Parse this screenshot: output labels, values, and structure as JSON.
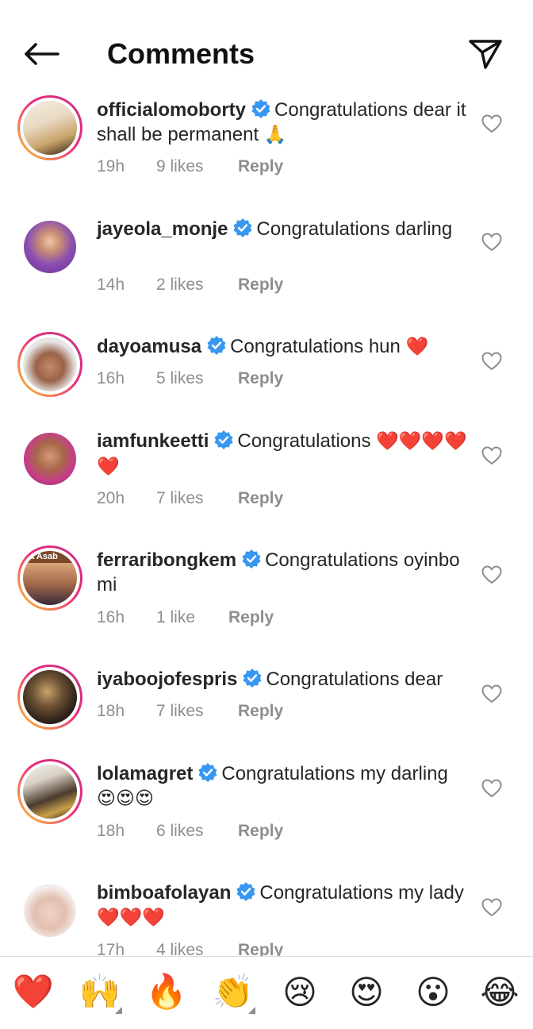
{
  "header": {
    "title": "Comments",
    "back_icon": "arrow-left-icon",
    "share_icon": "paper-plane-icon"
  },
  "comments": [
    {
      "username": "officialomoborty",
      "text": "Congratulations dear it shall be permanent",
      "emoji": "🙏",
      "time": "19h",
      "likes": "9 likes",
      "reply": "Reply",
      "avatar_color": "#e9d9c3"
    },
    {
      "username": "jayeola_monje",
      "text": "Congratulations darling",
      "emoji": "",
      "time": "14h",
      "likes": "2 likes",
      "reply": "Reply",
      "avatar_color": "#8a4fb0"
    },
    {
      "username": "dayoamusa",
      "text": "Congratulations hun",
      "emoji": "❤️",
      "time": "16h",
      "likes": "5 likes",
      "reply": "Reply",
      "avatar_color": "#d8d8d8"
    },
    {
      "username": "iamfunkeetti",
      "text": "Congratulations",
      "emoji": "❤️❤️❤️❤️❤️",
      "time": "20h",
      "likes": "7 likes",
      "reply": "Reply",
      "avatar_color": "#8a5a3a"
    },
    {
      "username": "ferraribongkem",
      "text": "Congratulations oyinbo mi",
      "emoji": "",
      "time": "16h",
      "likes": "1 like",
      "reply": "Reply",
      "avatar_color": "#a56a4a",
      "avatar_text": "ya Asab"
    },
    {
      "username": "iyaboojofespris",
      "text": "Congratulations dear",
      "emoji": "",
      "time": "18h",
      "likes": "7 likes",
      "reply": "Reply",
      "avatar_color": "#3b2e20"
    },
    {
      "username": "lolamagret",
      "text": "Congratulations my darling",
      "emoji": "😍😍😍",
      "time": "18h",
      "likes": "6 likes",
      "reply": "Reply",
      "avatar_color": "#4a3a2c"
    },
    {
      "username": "bimboafolayan",
      "text": "Congratulations my lady",
      "emoji": "❤️❤️❤️",
      "time": "17h",
      "likes": "4 likes",
      "reply": "Reply",
      "avatar_color": "#e7cfc4"
    }
  ],
  "reactions": [
    {
      "emoji": "❤️",
      "name": "heart"
    },
    {
      "emoji": "🙌",
      "name": "raising-hands"
    },
    {
      "emoji": "🔥",
      "name": "fire"
    },
    {
      "emoji": "👏",
      "name": "clapping-hands"
    },
    {
      "emoji": "😢",
      "name": "crying-face"
    },
    {
      "emoji": "😍",
      "name": "heart-eyes"
    },
    {
      "emoji": "😮",
      "name": "surprised-face"
    },
    {
      "emoji": "😂",
      "name": "tears-of-joy"
    }
  ],
  "colors": {
    "verified": "#3897f0",
    "muted": "#8e8e8e",
    "text": "#262626",
    "story_ring_start": "#f9ce34",
    "story_ring_end": "#c13584"
  }
}
